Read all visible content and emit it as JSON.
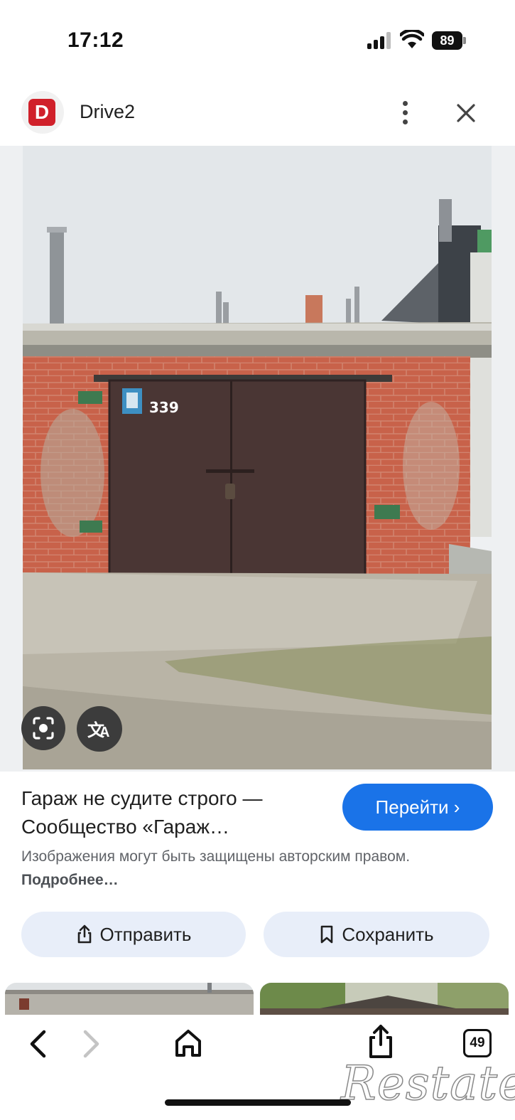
{
  "status_bar": {
    "time": "17:12",
    "battery": "89"
  },
  "source": {
    "logo_letter": "D",
    "name": "Drive2",
    "brand_color": "#d0202a"
  },
  "photo": {
    "door_number": "339"
  },
  "result": {
    "title": "Гараж не судите строго — Сообщество «Гараж…",
    "visit_label": "Перейти ›",
    "copyright_text": "Изображения могут быть защищены авторским правом.",
    "more_link": "Подробнее…"
  },
  "actions": {
    "share_label": "Отправить",
    "save_label": "Сохранить"
  },
  "toolbar": {
    "tabs_count": "49"
  },
  "watermark": "Restate",
  "colors": {
    "accent": "#1a73e8",
    "chip_bg": "#e8eef9"
  }
}
